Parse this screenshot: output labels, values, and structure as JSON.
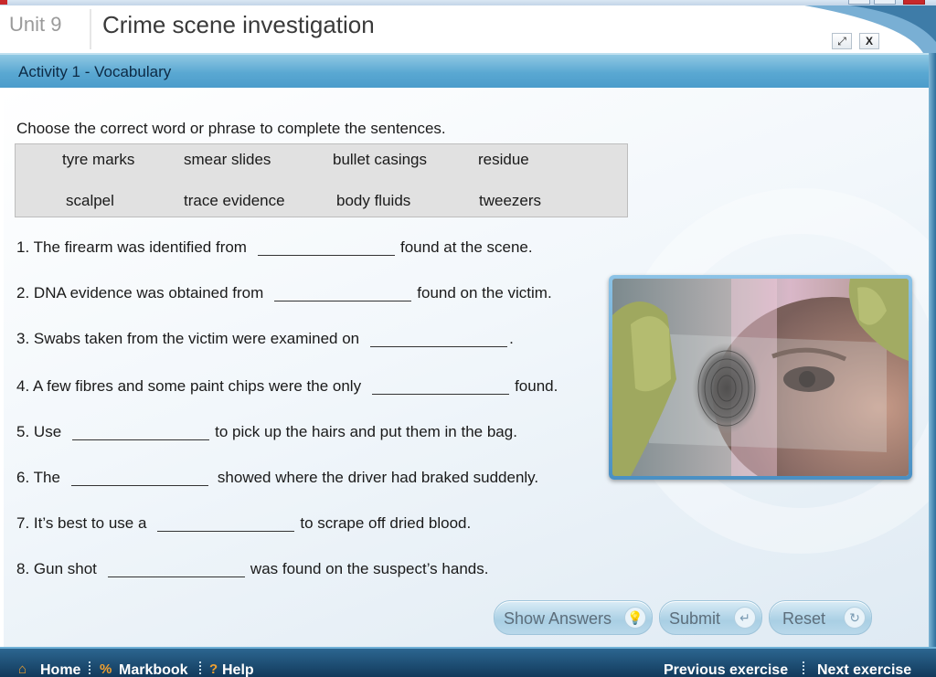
{
  "window": {
    "title_partial": ""
  },
  "header": {
    "unit": "Unit 9",
    "title": "Crime scene investigation",
    "fullscreen_icon": "expand-icon",
    "close_label": "X"
  },
  "activity": {
    "title": "Activity 1 - Vocabulary"
  },
  "instruction": "Choose the correct word or phrase to complete the sentences.",
  "word_bank": [
    "tyre marks",
    "smear slides",
    "bullet casings",
    "residue",
    "scalpel",
    "trace evidence",
    "body fluids",
    "tweezers"
  ],
  "questions": [
    {
      "num": "1.",
      "before": "The firearm was identified from",
      "after": "found at the scene."
    },
    {
      "num": "2.",
      "before": "DNA evidence was obtained from",
      "after": "found on the victim."
    },
    {
      "num": "3.",
      "before": "Swabs taken from the victim were examined on",
      "after": "."
    },
    {
      "num": "4.",
      "before": "A few fibres and some paint chips were the only",
      "after": "found."
    },
    {
      "num": "5.",
      "before": "Use",
      "after": "to pick up the hairs and put them in the bag."
    },
    {
      "num": "6.",
      "before": "The",
      "after": "showed where the driver had braked suddenly."
    },
    {
      "num": "7.",
      "before": "It’s best to use a",
      "after": "to scrape off dried blood."
    },
    {
      "num": "8.",
      "before": "Gun shot",
      "after": "was found on the suspect’s hands."
    }
  ],
  "buttons": {
    "show_answers": "Show Answers",
    "show_answers_icon": "lightbulb-icon",
    "submit": "Submit",
    "submit_icon": "enter-arrow-icon",
    "reset": "Reset",
    "reset_icon": "refresh-icon"
  },
  "footer": {
    "home": "Home",
    "markbook": "Markbook",
    "help": "Help",
    "previous": "Previous exercise",
    "next": "Next exercise"
  },
  "colors": {
    "activity_bar": "#5aa8d2",
    "footer": "#123a5c",
    "accent_orange": "#f0a030"
  }
}
